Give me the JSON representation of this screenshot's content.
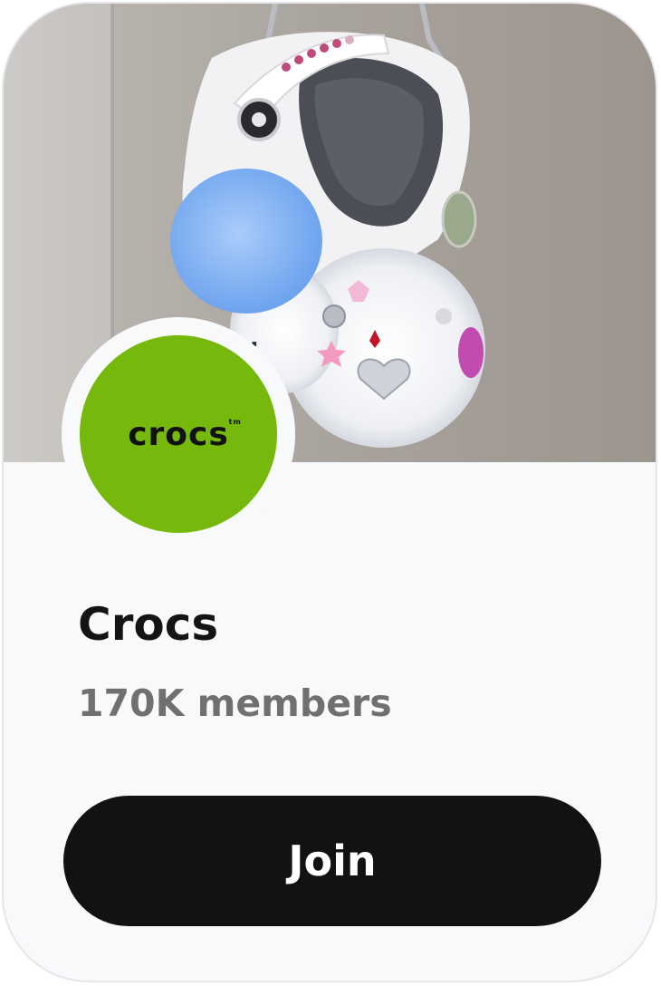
{
  "community": {
    "name": "Crocs",
    "members": "170K members",
    "logo_text": "crocs",
    "logo_tm": "tm",
    "brand_color": "#76b80b"
  },
  "cover": {
    "image": "decorated-white-croc-clog-photo"
  },
  "join_label": "Join"
}
